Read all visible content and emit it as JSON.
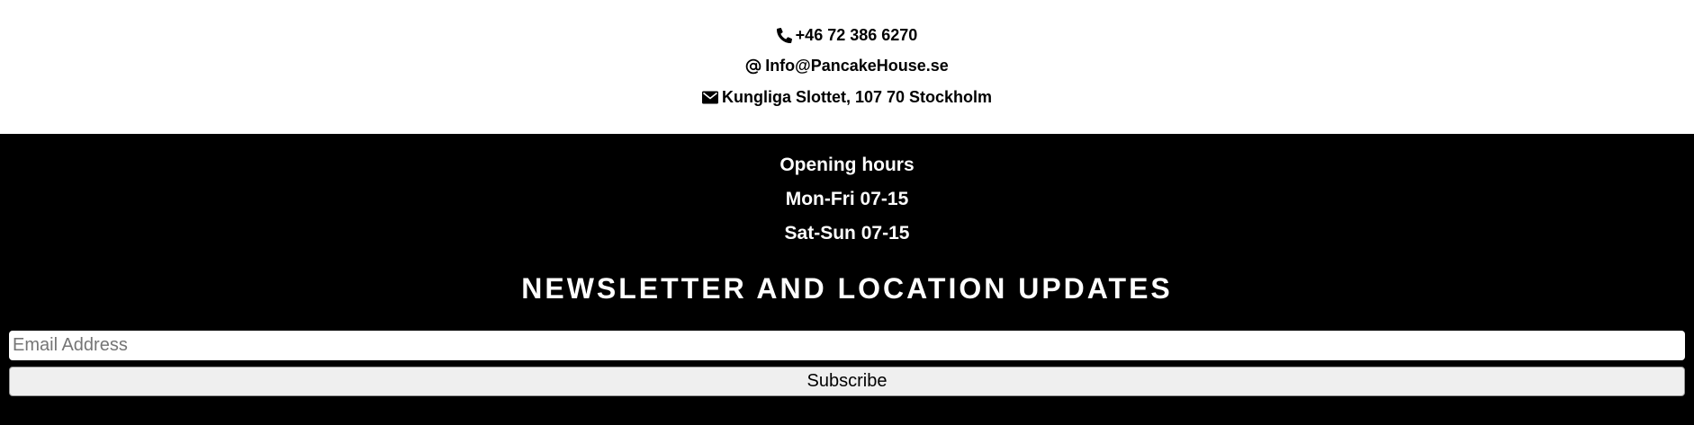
{
  "contact": {
    "phone": "+46 72 386 6270",
    "email": "Info@PancakeHouse.se",
    "address": "Kungliga Slottet, 107 70 Stockholm",
    "icons": {
      "phone": "phone-icon",
      "email": "at-icon",
      "address": "envelope-icon"
    }
  },
  "hours": {
    "title": "Opening hours",
    "weekdays": "Mon-Fri 07-15",
    "weekend": "Sat-Sun 07-15"
  },
  "newsletter": {
    "title": "NEWSLETTER AND LOCATION UPDATES",
    "email_placeholder": "Email Address",
    "email_value": "",
    "subscribe_label": "Subscribe"
  },
  "colors": {
    "footer_background": "#000000",
    "contact_background": "#ffffff",
    "button_background": "#efefef"
  }
}
